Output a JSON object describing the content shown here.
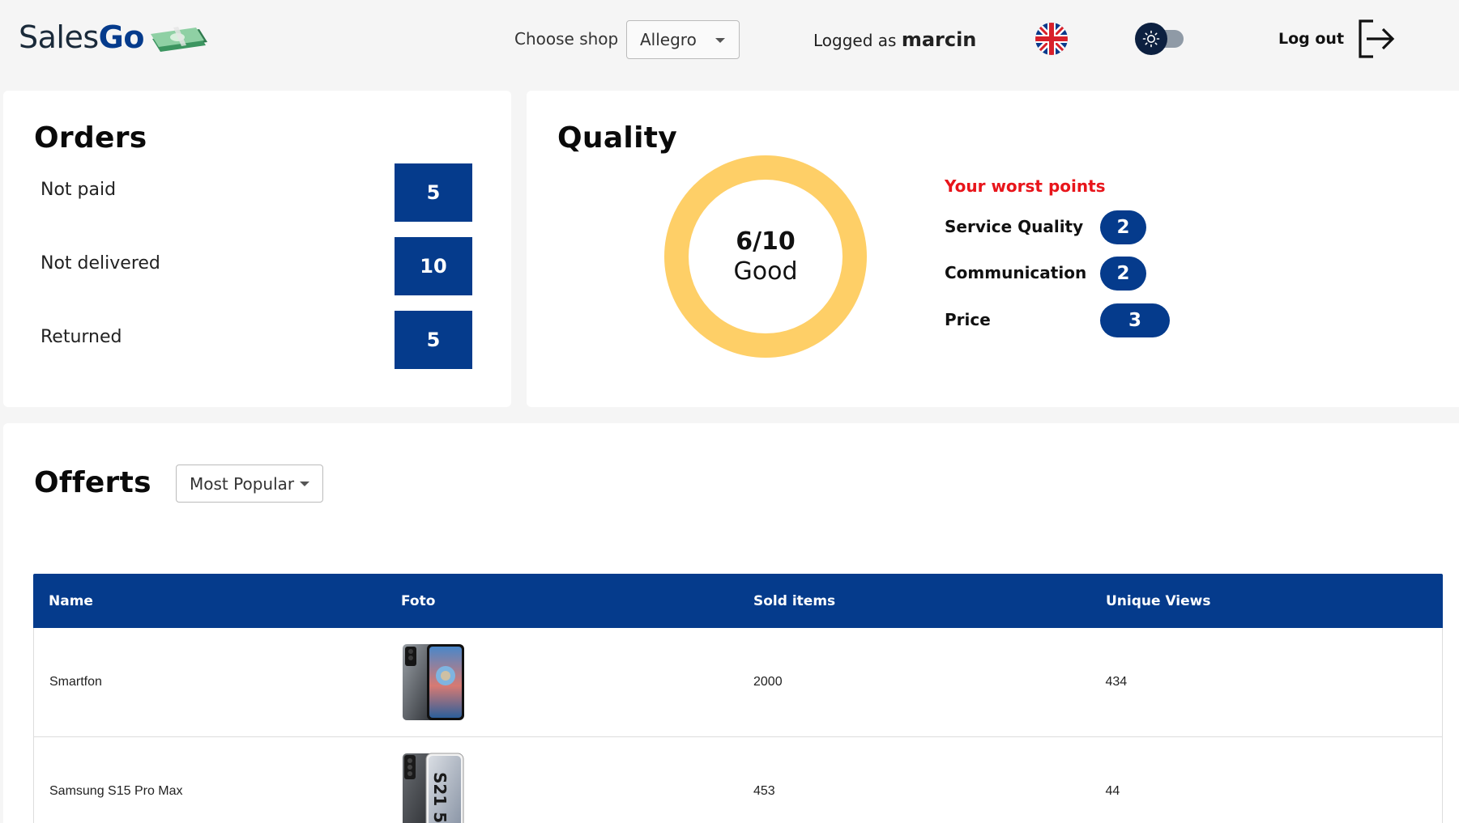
{
  "header": {
    "logo_left": "Sales",
    "logo_right": "Go",
    "choose_shop_label": "Choose shop",
    "shop_selected": "Allegro",
    "logged_prefix": "Logged as",
    "username": "marcin",
    "logout_label": "Log out",
    "icons": [
      "money-stack-icon",
      "uk-flag-icon",
      "sun-icon",
      "logout-icon",
      "chevron-down-icon"
    ]
  },
  "orders": {
    "title": "Orders",
    "rows": [
      {
        "label": "Not paid",
        "count": "5"
      },
      {
        "label": "Not delivered",
        "count": "10"
      },
      {
        "label": "Returned",
        "count": "5"
      }
    ]
  },
  "quality": {
    "title": "Quality",
    "score": "6/10",
    "rating": "Good",
    "worst_title": "Your worst points",
    "worst_points": [
      {
        "label": "Service Quality",
        "value": "2"
      },
      {
        "label": "Communication",
        "value": "2"
      },
      {
        "label": "Price",
        "value": "3"
      }
    ]
  },
  "offers": {
    "title": "Offerts",
    "sort_selected": "Most Popular",
    "columns": [
      "Name",
      "Foto",
      "Sold items",
      "Unique Views"
    ],
    "rows": [
      {
        "name": "Smartfon",
        "sold": "2000",
        "views": "434"
      },
      {
        "name": "Samsung S15 Pro Max",
        "sold": "453",
        "views": "44"
      }
    ]
  },
  "colors": {
    "primary": "#053b8c",
    "donut": "#fecf67",
    "warning_text": "#e8151b",
    "background": "#f5f5f5"
  }
}
